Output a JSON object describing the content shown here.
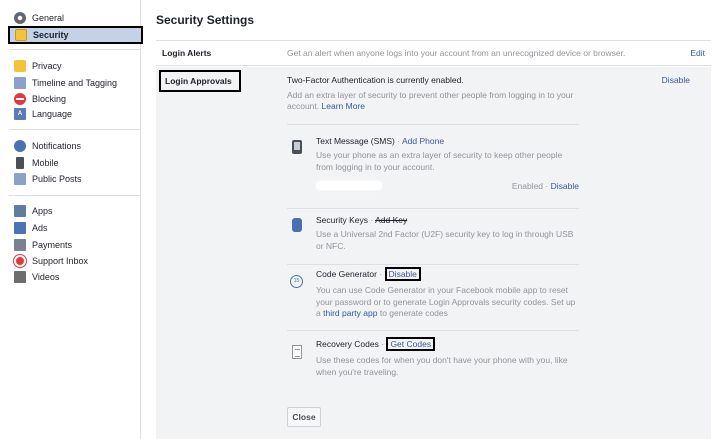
{
  "sidebar": {
    "groups": [
      [
        {
          "label": "General",
          "icon": "gear-icon"
        },
        {
          "label": "Security",
          "icon": "lock-icon",
          "active": true
        }
      ],
      [
        {
          "label": "Privacy",
          "icon": "privacy-icon"
        },
        {
          "label": "Timeline and Tagging",
          "icon": "timeline-icon"
        },
        {
          "label": "Blocking",
          "icon": "block-icon"
        },
        {
          "label": "Language",
          "icon": "language-icon"
        }
      ],
      [
        {
          "label": "Notifications",
          "icon": "globe-icon"
        },
        {
          "label": "Mobile",
          "icon": "mobile-icon"
        },
        {
          "label": "Public Posts",
          "icon": "public-posts-icon"
        }
      ],
      [
        {
          "label": "Apps",
          "icon": "apps-icon"
        },
        {
          "label": "Ads",
          "icon": "ads-icon"
        },
        {
          "label": "Payments",
          "icon": "payments-icon"
        },
        {
          "label": "Support Inbox",
          "icon": "lifebuoy-icon"
        },
        {
          "label": "Videos",
          "icon": "film-icon"
        }
      ]
    ],
    "language_icon_text": "A"
  },
  "main": {
    "title": "Security Settings",
    "login_alerts": {
      "title": "Login Alerts",
      "description": "Get an alert when anyone logs into your account from an unrecognized device or browser.",
      "edit": "Edit"
    },
    "login_approvals": {
      "title": "Login Approvals",
      "status": "Two-Factor Authentication is currently enabled.",
      "disable": "Disable",
      "description": "Add an extra layer of security to prevent other people from logging in to your account.",
      "learn_more": "Learn More",
      "methods": {
        "sms": {
          "title": "Text Message (SMS)",
          "separator": "·",
          "action": "Add Phone",
          "description": "Use your phone as an extra layer of security to keep other people from logging in to your account.",
          "status": "Enabled",
          "status_action": "Disable"
        },
        "keys": {
          "title": "Security Keys",
          "separator": "·",
          "action": "Add Key",
          "description": "Use a Universal 2nd Factor (U2F) security key to log in through USB or NFC."
        },
        "generator": {
          "title": "Code Generator",
          "separator": "·",
          "action": "Disable",
          "icon_text": "15",
          "description": "You can use Code Generator in your Facebook mobile app to reset your password or to generate Login Approvals security codes. Set up a",
          "link": "third party app",
          "description_end": "to generate codes"
        },
        "recovery": {
          "title": "Recovery Codes",
          "separator": "·",
          "action": "Get Codes",
          "description": "Use these codes for when you don't have your phone with you, like when you're traveling."
        }
      },
      "close": "Close"
    }
  },
  "colors": {
    "link": "#365899",
    "muted": "#90949c",
    "active_bg": "#c4d2e7",
    "panel_bg": "#f2f3f5",
    "divider": "#dddfe2"
  }
}
